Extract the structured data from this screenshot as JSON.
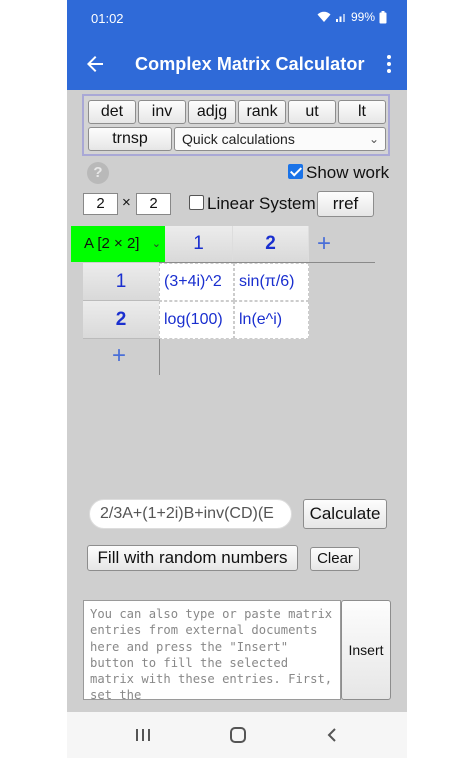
{
  "status": {
    "time": "01:02",
    "battery": "99%"
  },
  "appbar": {
    "title": "Complex Matrix Calculator"
  },
  "ops": {
    "det": "det",
    "inv": "inv",
    "adjg": "adjg",
    "rank": "rank",
    "ut": "ut",
    "lt": "lt",
    "trnsp": "trnsp",
    "quick": "Quick calculations"
  },
  "help": "?",
  "show_work": {
    "label": "Show work",
    "checked": true
  },
  "dims": {
    "rows": "2",
    "times": "×",
    "cols": "2"
  },
  "linear_system": {
    "label": "Linear System",
    "checked": false
  },
  "rref": "rref",
  "matrix": {
    "name": "A [2 × 2]",
    "col_headers": [
      "1",
      "2"
    ],
    "row_headers": [
      "1",
      "2"
    ],
    "cells": [
      [
        "(3+4i)^2",
        "sin(π/6)"
      ],
      [
        "log(100)",
        "ln(e^i)"
      ]
    ],
    "add": "+"
  },
  "expression": {
    "value": "2/3A+(1+2i)B+inv(CD)(E"
  },
  "calculate": "Calculate",
  "fill_random": "Fill with random numbers",
  "clear": "Clear",
  "paste_area": {
    "placeholder": "You can also type or paste matrix entries from external documents here and press the \"Insert\" button to fill the selected matrix with these entries. First, set the"
  },
  "insert": "Insert"
}
